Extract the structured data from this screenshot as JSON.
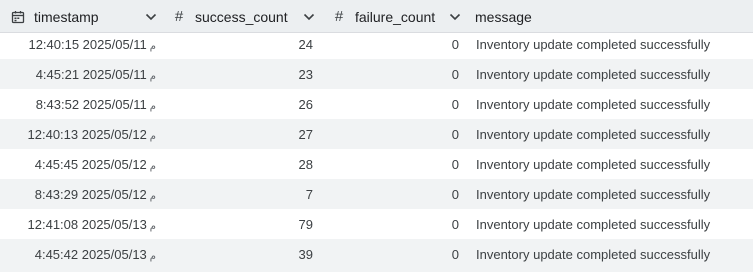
{
  "columns": [
    {
      "key": "timestamp",
      "label": "timestamp",
      "type_icon": "calendar-icon"
    },
    {
      "key": "success_count",
      "label": "success_count",
      "type_icon": "hash-icon"
    },
    {
      "key": "failure_count",
      "label": "failure_count",
      "type_icon": "hash-icon"
    },
    {
      "key": "message",
      "label": "message",
      "type_icon": ""
    }
  ],
  "hash_symbol": "#",
  "rows": [
    {
      "time": "12:40:15 2025/05/11",
      "suffix": "م",
      "success": "24",
      "failure": "0",
      "message": "Inventory update completed successfully"
    },
    {
      "time": "4:45:21 2025/05/11",
      "suffix": "م",
      "success": "23",
      "failure": "0",
      "message": "Inventory update completed successfully"
    },
    {
      "time": "8:43:52 2025/05/11",
      "suffix": "م",
      "success": "26",
      "failure": "0",
      "message": "Inventory update completed successfully"
    },
    {
      "time": "12:40:13 2025/05/12",
      "suffix": "م",
      "success": "27",
      "failure": "0",
      "message": "Inventory update completed successfully"
    },
    {
      "time": "4:45:45 2025/05/12",
      "suffix": "م",
      "success": "28",
      "failure": "0",
      "message": "Inventory update completed successfully"
    },
    {
      "time": "8:43:29 2025/05/12",
      "suffix": "م",
      "success": "7",
      "failure": "0",
      "message": "Inventory update completed successfully"
    },
    {
      "time": "12:41:08 2025/05/13",
      "suffix": "م",
      "success": "79",
      "failure": "0",
      "message": "Inventory update completed successfully"
    },
    {
      "time": "4:45:42 2025/05/13",
      "suffix": "م",
      "success": "39",
      "failure": "0",
      "message": "Inventory update completed successfully"
    }
  ]
}
